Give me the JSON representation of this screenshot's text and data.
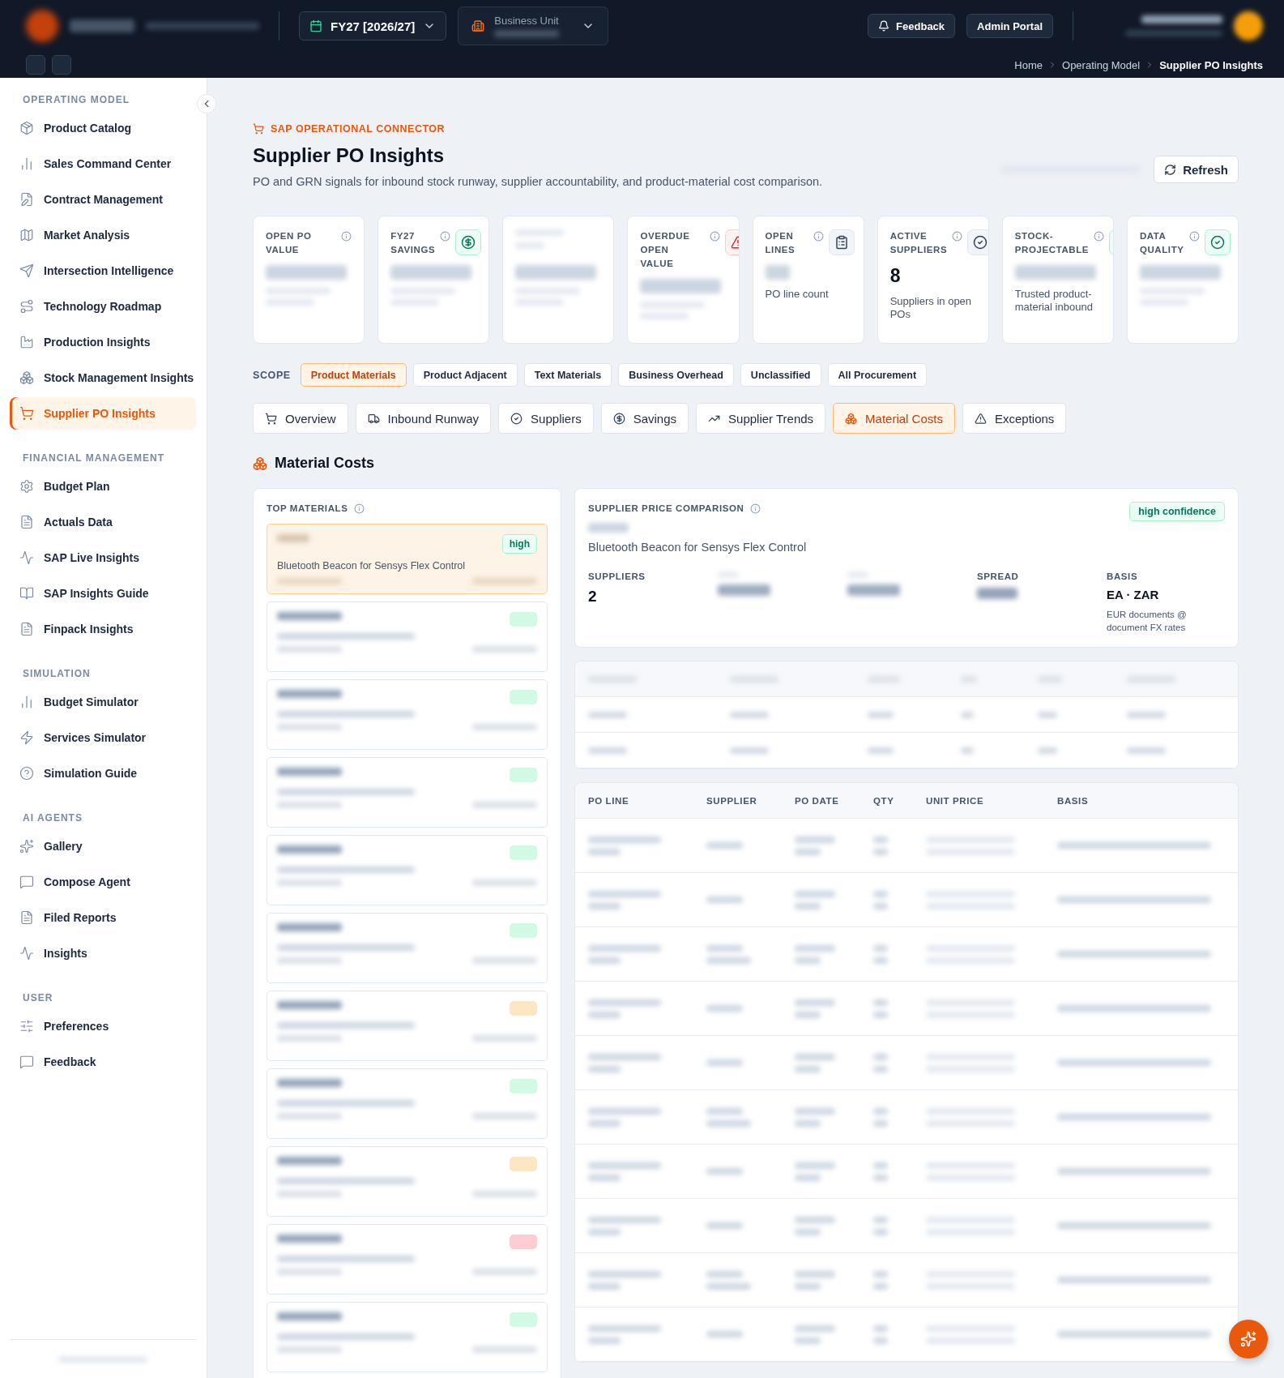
{
  "header": {
    "fiscal_year": "FY27 [2026/27]",
    "business_unit_label": "Business Unit",
    "buttons": [
      "Feedback",
      "Admin Portal"
    ],
    "breadcrumb": [
      {
        "label": "Home",
        "current": false
      },
      {
        "label": "Operating Model",
        "current": false
      },
      {
        "label": "Supplier PO Insights",
        "current": true
      }
    ]
  },
  "sidebar": {
    "sections": [
      {
        "title": "OPERATING MODEL",
        "items": [
          {
            "label": "Product Catalog",
            "selected": false
          },
          {
            "label": "Sales Command Center",
            "selected": false
          },
          {
            "label": "Contract Management",
            "selected": false
          },
          {
            "label": "Market Analysis",
            "selected": false
          },
          {
            "label": "Intersection Intelligence",
            "selected": false
          },
          {
            "label": "Technology Roadmap",
            "selected": false
          },
          {
            "label": "Production Insights",
            "selected": false
          },
          {
            "label": "Stock Management Insights",
            "selected": false
          },
          {
            "label": "Supplier PO Insights",
            "selected": true
          }
        ]
      },
      {
        "title": "FINANCIAL MANAGEMENT",
        "items": [
          {
            "label": "Budget Plan",
            "selected": false
          },
          {
            "label": "Actuals Data",
            "selected": false
          },
          {
            "label": "SAP Live Insights",
            "selected": false
          },
          {
            "label": "SAP Insights Guide",
            "selected": false
          },
          {
            "label": "Finpack Insights",
            "selected": false
          }
        ]
      },
      {
        "title": "SIMULATION",
        "items": [
          {
            "label": "Budget Simulator",
            "selected": false
          },
          {
            "label": "Services Simulator",
            "selected": false
          },
          {
            "label": "Simulation Guide",
            "selected": false
          }
        ]
      },
      {
        "title": "AI AGENTS",
        "items": [
          {
            "label": "Gallery",
            "selected": false
          },
          {
            "label": "Compose Agent",
            "selected": false
          },
          {
            "label": "Filed Reports",
            "selected": false
          },
          {
            "label": "Insights",
            "selected": false
          }
        ]
      },
      {
        "title": "USER",
        "items": [
          {
            "label": "Preferences",
            "selected": false
          },
          {
            "label": "Feedback",
            "selected": false
          }
        ]
      }
    ]
  },
  "page": {
    "eyebrow": "SAP OPERATIONAL CONNECTOR",
    "title": "Supplier PO Insights",
    "subtitle": "PO and GRN signals for inbound stock runway, supplier accountability, and product-material cost comparison.",
    "refresh_button": "Refresh"
  },
  "kpis": [
    {
      "title": "OPEN PO VALUE",
      "kind": "none"
    },
    {
      "title": "FY27 SAVINGS",
      "kind": "dollar"
    },
    {
      "kind": "blurred"
    },
    {
      "title": "OVERDUE OPEN VALUE",
      "kind": "alert"
    },
    {
      "title": "OPEN LINES",
      "kind": "clipboard",
      "note": "PO line count"
    },
    {
      "title": "ACTIVE SUPPLIERS",
      "kind": "check",
      "value": "8",
      "note": "Suppliers in open POs"
    },
    {
      "title": "STOCK-PROJECTABLE",
      "kind": "boxes",
      "note": "Trusted product-material inbound"
    },
    {
      "title": "DATA QUALITY",
      "kind": "check-green"
    }
  ],
  "scope": {
    "label": "SCOPE",
    "options": [
      {
        "label": "Product Materials",
        "selected": true
      },
      {
        "label": "Product Adjacent",
        "selected": false
      },
      {
        "label": "Text Materials",
        "selected": false
      },
      {
        "label": "Business Overhead",
        "selected": false
      },
      {
        "label": "Unclassified",
        "selected": false
      },
      {
        "label": "All Procurement",
        "selected": false
      }
    ]
  },
  "tabs": [
    {
      "label": "Overview",
      "selected": false
    },
    {
      "label": "Inbound Runway",
      "selected": false
    },
    {
      "label": "Suppliers",
      "selected": false
    },
    {
      "label": "Savings",
      "selected": false
    },
    {
      "label": "Supplier Trends",
      "selected": false
    },
    {
      "label": "Material Costs",
      "selected": true
    },
    {
      "label": "Exceptions",
      "selected": false
    }
  ],
  "section_title": "Material Costs",
  "top_materials": {
    "title": "TOP MATERIALS",
    "items": [
      {
        "selected": true,
        "name": "Bluetooth Beacon for Sensys Flex Control",
        "badge": "high",
        "color": "#047857"
      },
      {
        "selected": false,
        "color": "#d1fae5"
      },
      {
        "selected": false,
        "color": "#d1fae5"
      },
      {
        "selected": false,
        "color": "#d1fae5"
      },
      {
        "selected": false,
        "color": "#d1fae5"
      },
      {
        "selected": false,
        "color": "#d1fae5"
      },
      {
        "selected": false,
        "color": "#fde7c2"
      },
      {
        "selected": false,
        "color": "#d1fae5"
      },
      {
        "selected": false,
        "color": "#fde7c2"
      },
      {
        "selected": false,
        "color": "#fecdd3"
      },
      {
        "selected": false,
        "color": "#d1fae5"
      }
    ]
  },
  "comparison": {
    "title": "SUPPLIER PRICE COMPARISON",
    "confidence": "high confidence",
    "material": "Bluetooth Beacon for Sensys Flex Control",
    "stats": [
      {
        "label": "SUPPLIERS",
        "value": "2"
      },
      {
        "kind": "blurred"
      },
      {
        "kind": "blurred"
      },
      {
        "label": "SPREAD",
        "kind": "label-only"
      },
      {
        "label": "BASIS",
        "value": "EA · ZAR",
        "note": "EUR documents @ document FX rates"
      }
    ]
  },
  "po_lines": {
    "columns": [
      "PO LINE",
      "SUPPLIER",
      "PO DATE",
      "QTY",
      "UNIT PRICE",
      "BASIS"
    ]
  }
}
